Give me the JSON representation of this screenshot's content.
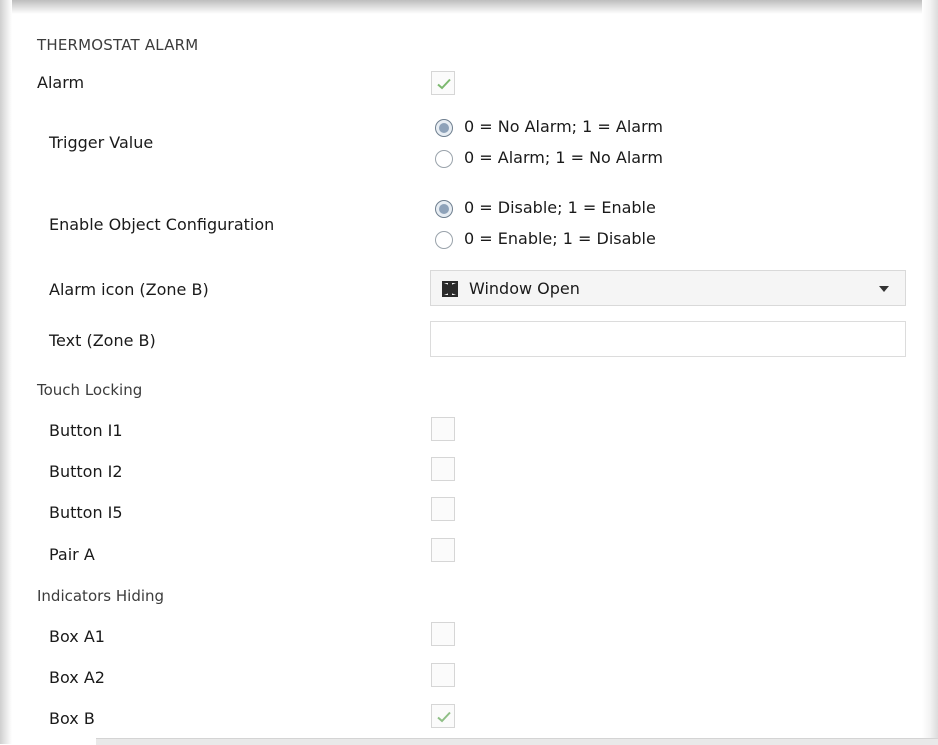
{
  "section_title": "THERMOSTAT ALARM",
  "alarm": {
    "label": "Alarm",
    "checked": true
  },
  "trigger_value": {
    "label": "Trigger Value",
    "options": [
      "0 = No Alarm; 1 = Alarm",
      "0 = Alarm; 1 = No Alarm"
    ],
    "selected_index": 0
  },
  "enable_object": {
    "label": "Enable Object Configuration",
    "options": [
      "0 = Disable; 1 = Enable",
      "0 = Enable; 1 = Disable"
    ],
    "selected_index": 0
  },
  "alarm_icon": {
    "label": "Alarm icon (Zone B)",
    "value": "Window Open",
    "icon": "window-open-icon"
  },
  "text_zone": {
    "label": "Text (Zone B)",
    "value": ""
  },
  "touch_locking": {
    "title": "Touch Locking",
    "items": [
      {
        "label": "Button I1",
        "checked": false
      },
      {
        "label": "Button I2",
        "checked": false
      },
      {
        "label": "Button I5",
        "checked": false
      },
      {
        "label": "Pair A",
        "checked": false
      }
    ]
  },
  "indicators_hiding": {
    "title": "Indicators Hiding",
    "items": [
      {
        "label": "Box A1",
        "checked": false
      },
      {
        "label": "Box A2",
        "checked": false
      },
      {
        "label": "Box B",
        "checked": true
      }
    ]
  },
  "colors": {
    "check": "#7cb86e",
    "radio_selected": "#8ea2b9",
    "border": "#d6d6d6"
  }
}
